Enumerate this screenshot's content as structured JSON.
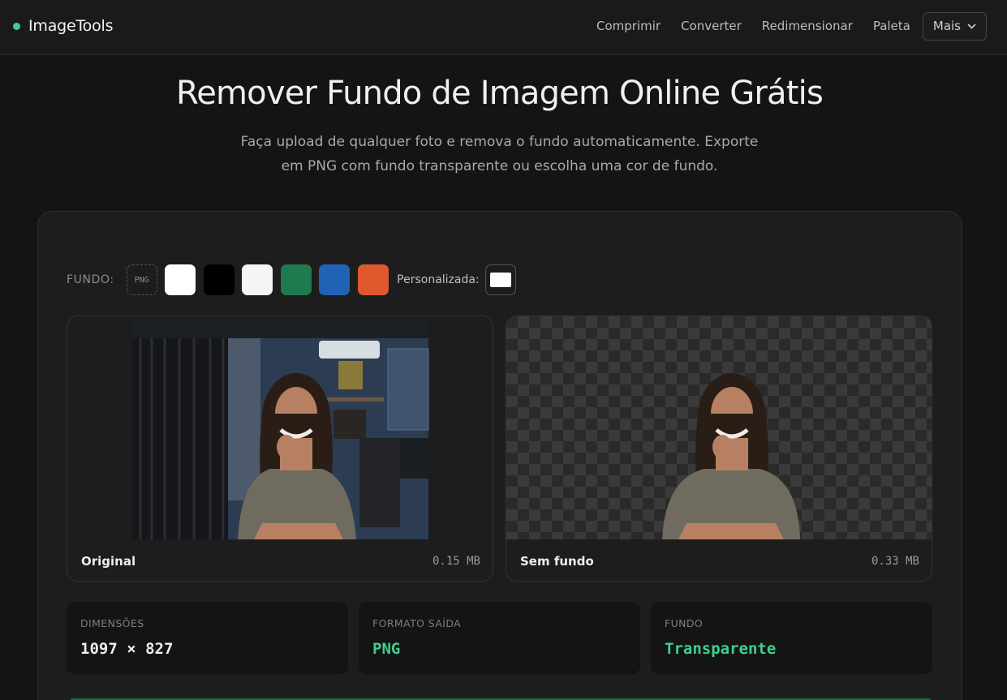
{
  "app": {
    "name": "ImageTools",
    "accent": "#3ecf8e"
  },
  "nav": {
    "links": [
      "Comprimir",
      "Converter",
      "Redimensionar",
      "Paleta"
    ],
    "more_label": "Mais"
  },
  "hero": {
    "title": "Remover Fundo de Imagem Online Grátis",
    "subtitle_line1": "Faça upload de qualquer foto e remova o fundo automaticamente. Exporte",
    "subtitle_line2": "em PNG com fundo transparente ou escolha uma cor de fundo."
  },
  "background_picker": {
    "label": "FUNDO:",
    "png_label": "PNG",
    "swatches": [
      "#ffffff",
      "#000000",
      "#f5f5f3",
      "#1f7a4e",
      "#1e63b5",
      "#e0592e"
    ],
    "custom_label": "Personalizada:",
    "custom_color": "#ffffff"
  },
  "panels": {
    "original": {
      "name": "Original",
      "size": "0.15 MB"
    },
    "result": {
      "name": "Sem fundo",
      "size": "0.33 MB"
    }
  },
  "stats": [
    {
      "label": "DIMENSÕES",
      "value": "1097 × 827",
      "color": "#ededed"
    },
    {
      "label": "FORMATO SAÍDA",
      "value": "PNG",
      "color": "#3ecf8e"
    },
    {
      "label": "FUNDO",
      "value": "Transparente",
      "color": "#3ecf8e"
    }
  ]
}
